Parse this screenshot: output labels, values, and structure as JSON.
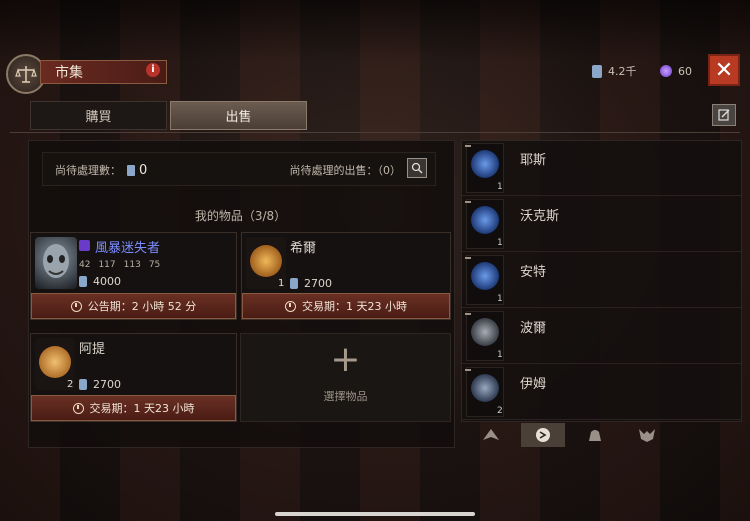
{
  "header": {
    "title": "市集",
    "info_symbol": "i",
    "currency_gold": "4.2千",
    "currency_gems": "60",
    "close_symbol": "✕"
  },
  "tabs": [
    {
      "label": "購買",
      "active": false
    },
    {
      "label": "出售",
      "active": true
    }
  ],
  "pending": {
    "count_label": "尚待處理數：",
    "count_value": "0",
    "sales_label": "尚待處理的出售：（0）"
  },
  "inventory": {
    "title": "我的物品（3/8）",
    "items": [
      {
        "name": "風暴迷失者",
        "rarity": "rare",
        "stats": [
          "42",
          "117",
          "113",
          "75"
        ],
        "price": "4000",
        "status": "公告期：2 小時 52 分"
      },
      {
        "name": "希爾",
        "quantity": "1",
        "price": "2700",
        "status": "交易期：1 天23 小時"
      },
      {
        "name": "阿提",
        "quantity": "2",
        "price": "2700",
        "status": "交易期：1 天23 小時"
      }
    ],
    "select_label": "選擇物品",
    "plus_symbol": "+"
  },
  "runes": [
    {
      "name": "耶斯",
      "quantity": "1",
      "color": "#3a6cc8"
    },
    {
      "name": "沃克斯",
      "quantity": "1",
      "color": "#3a6cc8"
    },
    {
      "name": "安特",
      "quantity": "1",
      "color": "#3a6cc8"
    },
    {
      "name": "波爾",
      "quantity": "1",
      "color": "#6a6e78"
    },
    {
      "name": "伊姆",
      "quantity": "2",
      "color": "#5a6478"
    }
  ],
  "colors": {
    "accent_red": "#b83a22",
    "rare_blue": "#7c8cff",
    "rune_orange": "#c8842a"
  }
}
